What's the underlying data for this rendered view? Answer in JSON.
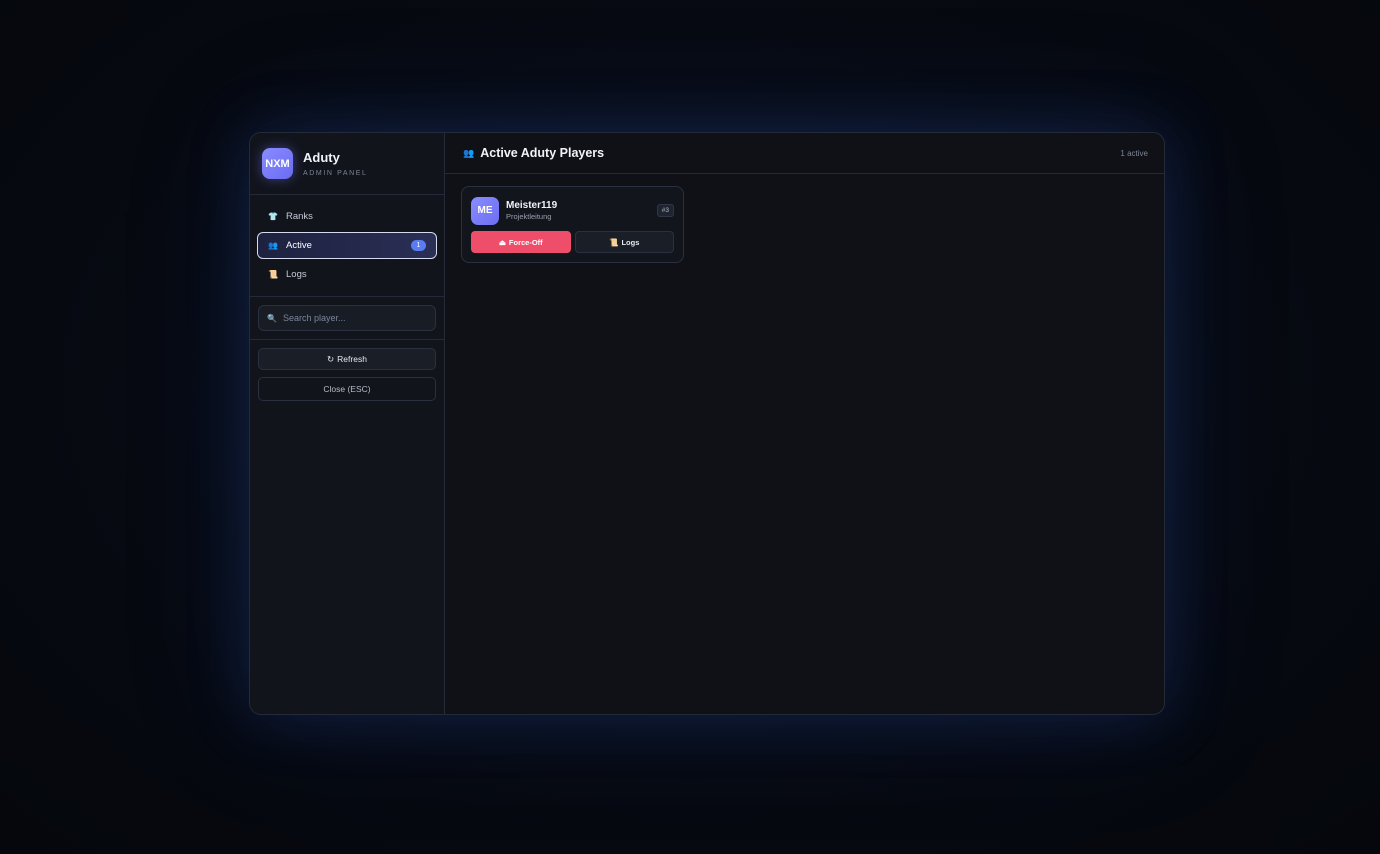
{
  "brand": {
    "logo": "NXM",
    "title": "Aduty",
    "subtitle": "ADMIN PANEL"
  },
  "nav": {
    "items": [
      {
        "label": "Ranks",
        "icon": "shirt-icon",
        "glyph": "👕",
        "active": false
      },
      {
        "label": "Active",
        "icon": "people-icon",
        "glyph": "👥",
        "active": true,
        "badge": "1"
      },
      {
        "label": "Logs",
        "icon": "scroll-icon",
        "glyph": "📜",
        "active": false
      }
    ]
  },
  "search": {
    "icon": "search-icon",
    "placeholder": "Search player..."
  },
  "actions": {
    "refresh_icon": "↻",
    "refresh_label": "Refresh",
    "close_label": "Close (ESC)"
  },
  "main": {
    "title_icon": "👥",
    "title": "Active Aduty Players",
    "count": "1 active"
  },
  "players": [
    {
      "initials": "ME",
      "name": "Meister119",
      "role": "Projektleitung",
      "id": "#3",
      "force_icon": "⏏",
      "force_label": "Force-Off",
      "logs_icon": "📜",
      "logs_label": "Logs"
    }
  ],
  "colors": {
    "accent": "#6a6cf2",
    "danger": "#ef4e6a",
    "badge": "#5b7cf0",
    "background": "#0f1117"
  }
}
